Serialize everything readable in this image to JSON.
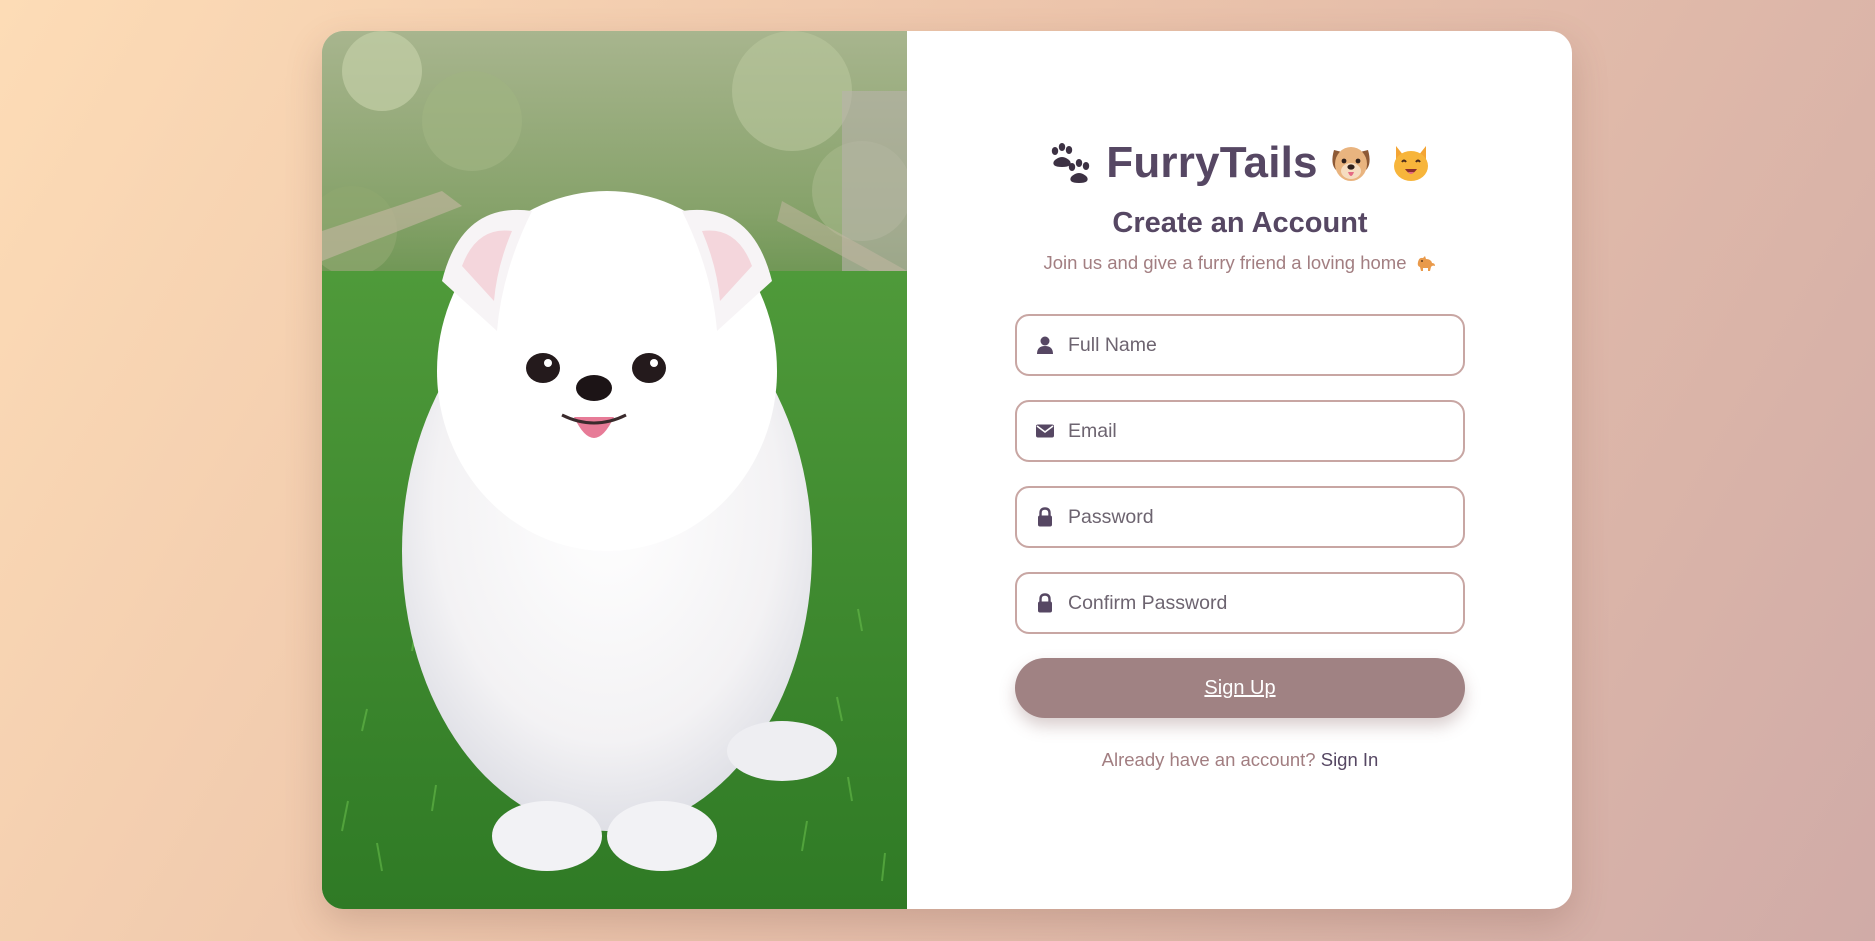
{
  "brand": {
    "name": "FurryTails",
    "icons": [
      "paw-prints-icon",
      "dog-face-icon",
      "cat-face-icon"
    ]
  },
  "heading": "Create an Account",
  "subtitle": {
    "text": "Join us and give a furry friend a loving home",
    "icon": "cat-icon"
  },
  "form": {
    "fields": [
      {
        "placeholder": "Full Name",
        "value": "",
        "icon": "user-icon"
      },
      {
        "placeholder": "Email",
        "value": "",
        "icon": "envelope-icon"
      },
      {
        "placeholder": "Password",
        "value": "",
        "icon": "lock-icon"
      },
      {
        "placeholder": "Confirm Password",
        "value": "",
        "icon": "lock-icon"
      }
    ],
    "submit_label": "Sign Up"
  },
  "signin": {
    "prompt": "Already have an account?",
    "link_label": "Sign In"
  },
  "colors": {
    "primary_text": "#564763",
    "muted_text": "#a27e81",
    "button_bg": "#a08283",
    "input_border": "#c8a6a3",
    "background_start": "#fddcb6",
    "background_end": "#d0aba7"
  }
}
